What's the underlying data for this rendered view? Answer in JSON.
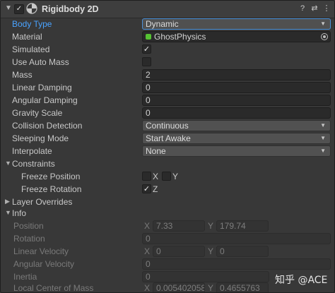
{
  "component": {
    "title": "Rigidbody 2D",
    "enabled_mark": "✓",
    "icons": [
      "chevron-down-icon",
      "rigidbody-2d-icon",
      "help-icon",
      "preset-icon",
      "context-menu-icon"
    ],
    "header_buttons": {
      "help": "?",
      "presets": "⇄",
      "menu": "⋮"
    }
  },
  "properties": {
    "body_type": {
      "label": "Body Type",
      "value": "Dynamic"
    },
    "material": {
      "label": "Material",
      "value": "GhostPhysics"
    },
    "simulated": {
      "label": "Simulated",
      "checked": "✓"
    },
    "use_auto_mass": {
      "label": "Use Auto Mass",
      "checked": ""
    },
    "mass": {
      "label": "Mass",
      "value": "2"
    },
    "linear_damping": {
      "label": "Linear Damping",
      "value": "0"
    },
    "angular_damping": {
      "label": "Angular Damping",
      "value": "0"
    },
    "gravity_scale": {
      "label": "Gravity Scale",
      "value": "0"
    },
    "collision_detection": {
      "label": "Collision Detection",
      "value": "Continuous"
    },
    "sleeping_mode": {
      "label": "Sleeping Mode",
      "value": "Start Awake"
    },
    "interpolate": {
      "label": "Interpolate",
      "value": "None"
    }
  },
  "constraints": {
    "label": "Constraints",
    "freeze_position": {
      "label": "Freeze Position",
      "x_label": "X",
      "y_label": "Y",
      "x_checked": "",
      "y_checked": ""
    },
    "freeze_rotation": {
      "label": "Freeze Rotation",
      "z_label": "Z",
      "z_checked": "✓"
    }
  },
  "layer_overrides": {
    "label": "Layer Overrides"
  },
  "info": {
    "label": "Info",
    "position": {
      "label": "Position",
      "x_label": "X",
      "x": "7.33",
      "y_label": "Y",
      "y": "179.74"
    },
    "rotation": {
      "label": "Rotation",
      "value": "0"
    },
    "linear_velocity": {
      "label": "Linear Velocity",
      "x_label": "X",
      "x": "0",
      "y_label": "Y",
      "y": "0"
    },
    "angular_velocity": {
      "label": "Angular Velocity",
      "value": "0"
    },
    "inertia": {
      "label": "Inertia",
      "value": "0"
    },
    "local_center_of_mass": {
      "label": "Local Center of Mass",
      "x_label": "X",
      "x": "0.005402058",
      "y_label": "Y",
      "y": "0.4655763"
    }
  },
  "watermark": "知乎 @ACE",
  "colors": {
    "accent": "#4aa3ff",
    "background": "#383838",
    "field": "#2a2a2a",
    "dropdown": "#515151",
    "icon_green": "#56c233"
  }
}
